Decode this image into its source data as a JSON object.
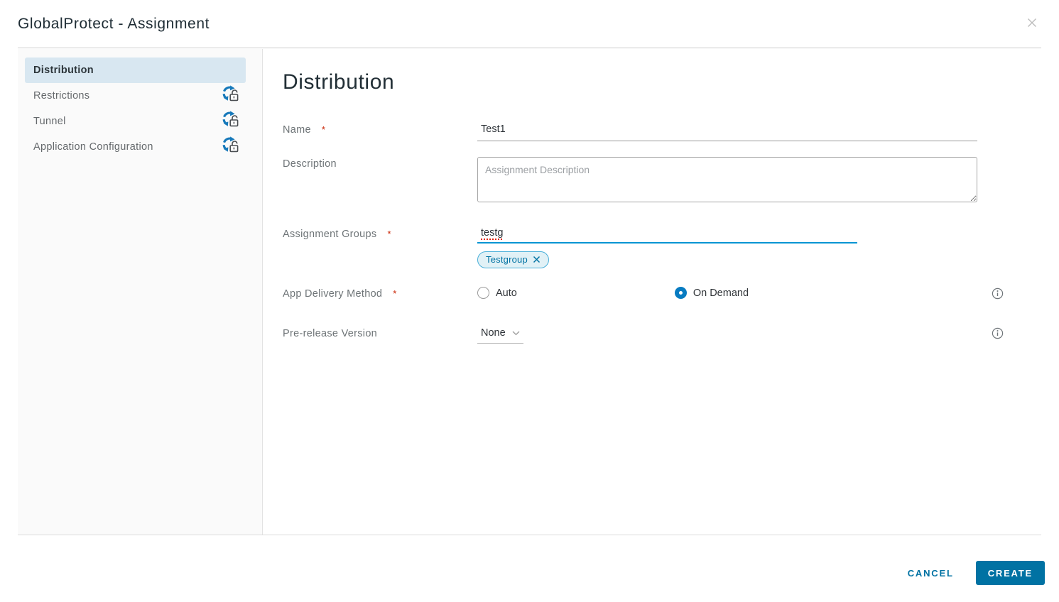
{
  "window": {
    "title": "GlobalProtect - Assignment"
  },
  "sidebar": {
    "items": [
      {
        "label": "Distribution",
        "selected": true,
        "override_unlocked": false
      },
      {
        "label": "Restrictions",
        "selected": false,
        "override_unlocked": true
      },
      {
        "label": "Tunnel",
        "selected": false,
        "override_unlocked": true
      },
      {
        "label": "Application Configuration",
        "selected": false,
        "override_unlocked": true
      }
    ]
  },
  "content": {
    "heading": "Distribution",
    "required_marker": "*",
    "name": {
      "label": "Name",
      "value": "Test1"
    },
    "description": {
      "label": "Description",
      "placeholder": "Assignment Description"
    },
    "assignment_groups": {
      "label": "Assignment Groups",
      "input_value": "testg",
      "chips": [
        {
          "label": "Testgroup"
        }
      ]
    },
    "app_delivery_method": {
      "label": "App Delivery Method",
      "options": [
        {
          "label": "Auto",
          "selected": false
        },
        {
          "label": "On Demand",
          "selected": true
        }
      ]
    },
    "pre_release_version": {
      "label": "Pre-release Version",
      "value": "None"
    }
  },
  "footer": {
    "cancel_label": "CANCEL",
    "create_label": "CREATE"
  },
  "icons": {
    "close": "close-x",
    "info": "circled-i",
    "chip_remove": "x",
    "dropdown_chevron": "chevron-down",
    "sidebar_override": "sync-arrows-open-padlock"
  },
  "colors": {
    "accent_blue": "#0072a3",
    "focus_underline": "#0095d3",
    "radio_selected": "#077bc1",
    "chip_bg": "#e1f1f6",
    "chip_border": "#49afd9",
    "selected_nav_bg": "#d8e7f1",
    "sidebar_bg": "#fafafa",
    "icon_arrows_blue": "#1779ba",
    "required_asterisk": "#c92100"
  }
}
